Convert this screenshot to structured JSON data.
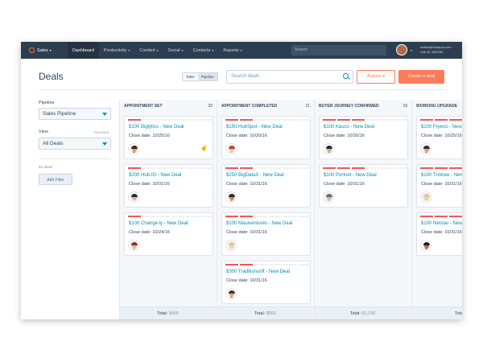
{
  "nav": {
    "brand": "Sales",
    "items": [
      "Dashboard",
      "Productivity",
      "Content",
      "Social",
      "Contacts",
      "Reports"
    ],
    "search_placeholder": "Search",
    "user_email": "melisa@hubspot.com",
    "hub_id": "Hub ID: 681533"
  },
  "header": {
    "title": "Deals",
    "view_table": "Table",
    "view_pipeline": "Pipeline",
    "search_placeholder": "Search deals",
    "actions_label": "Actions ▾",
    "create_label": "Create a deal"
  },
  "sidebar": {
    "pipeline_label": "Pipeline",
    "pipeline_value": "Sales Pipeline",
    "view_label": "View",
    "view_standard": "Standard",
    "view_value": "All Deals",
    "deal_count": "84 deals",
    "add_filter": "Add Filter"
  },
  "board": {
    "columns": [
      {
        "title": "Appointment Set",
        "count": "32",
        "total_label": "Total:",
        "total_value": "$400",
        "cards": [
          {
            "name": "$100 Biglytics - New Deal",
            "close": "Close date: 10/25/16",
            "stage": 1,
            "avatar": "man-beard"
          },
          {
            "name": "$200 Hub.IO - New Deal",
            "close": "Close date: 10/31/16",
            "stage": 1,
            "avatar": "man-glasses"
          },
          {
            "name": "$100 Change.ly - New Deal",
            "close": "Close date: 10/24/16",
            "stage": 1,
            "avatar": "man-brown"
          }
        ]
      },
      {
        "title": "Appointment Completed",
        "count": "21",
        "total_label": "Total:",
        "total_value": "$800",
        "cards": [
          {
            "name": "$150 HubSpot - New Deal",
            "close": "Close date: 10/20/16",
            "stage": 2,
            "avatar": "woman-red"
          },
          {
            "name": "$250 BigDataX - New Deal",
            "close": "Close date: 10/31/16",
            "stage": 2,
            "avatar": "woman-dark"
          },
          {
            "name": "$100 Mauiventures - New Deal",
            "close": "Close date: 10/31/16",
            "stage": 2,
            "avatar": "woman-blonde"
          },
          {
            "name": "$300 Traditionsoft - New Deal",
            "close": "Close date: 10/31/16",
            "stage": 2,
            "avatar": "man-young"
          }
        ]
      },
      {
        "title": "Buyer Journey Confirmed",
        "count": "19",
        "total_label": "Total:",
        "total_value": "$1,230",
        "cards": [
          {
            "name": "$100 Kasco - New Deal",
            "close": "Close date: 10/30/16",
            "stage": 3,
            "avatar": "man-green"
          },
          {
            "name": "$100 Portnet - New Deal",
            "close": "Close date: 10/31/16",
            "stage": 3,
            "avatar": "man-gray"
          }
        ]
      },
      {
        "title": "Working Upgrade",
        "count": "",
        "total_label": "Total:",
        "total_value": "",
        "cards": [
          {
            "name": "$100 Fryeco - New Deal",
            "close": "Close date: 10/25/16",
            "stage": 4,
            "avatar": "man-beard"
          },
          {
            "name": "$100 Trintree - New Deal",
            "close": "Close date: 10/31/16",
            "stage": 4,
            "avatar": "woman-blonde"
          },
          {
            "name": "$100 Netstar - New Deal",
            "close": "Close date: 10/31/16",
            "stage": 4,
            "avatar": "man-dark"
          }
        ]
      }
    ]
  },
  "colors": {
    "nav_bg": "#2d3e50",
    "accent": "#ff7a59",
    "link": "#0091ae",
    "stage_bar": "#f2545b"
  }
}
